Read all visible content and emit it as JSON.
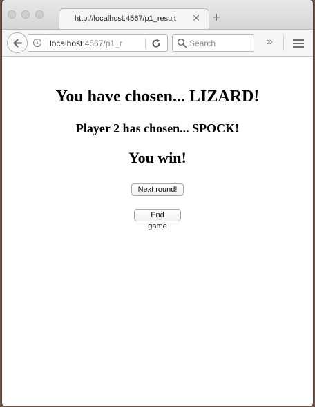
{
  "browser": {
    "tab_title": "http://localhost:4567/p1_result",
    "url_host": "localhost",
    "url_path": ":4567/p1_r",
    "search_placeholder": "Search"
  },
  "page": {
    "player1_choice_text": "You have chosen... LIZARD!",
    "player2_choice_text": "Player 2 has chosen... SPOCK!",
    "result_text": "You win!",
    "next_round_label": "Next round!",
    "end_game_label": "End game"
  }
}
